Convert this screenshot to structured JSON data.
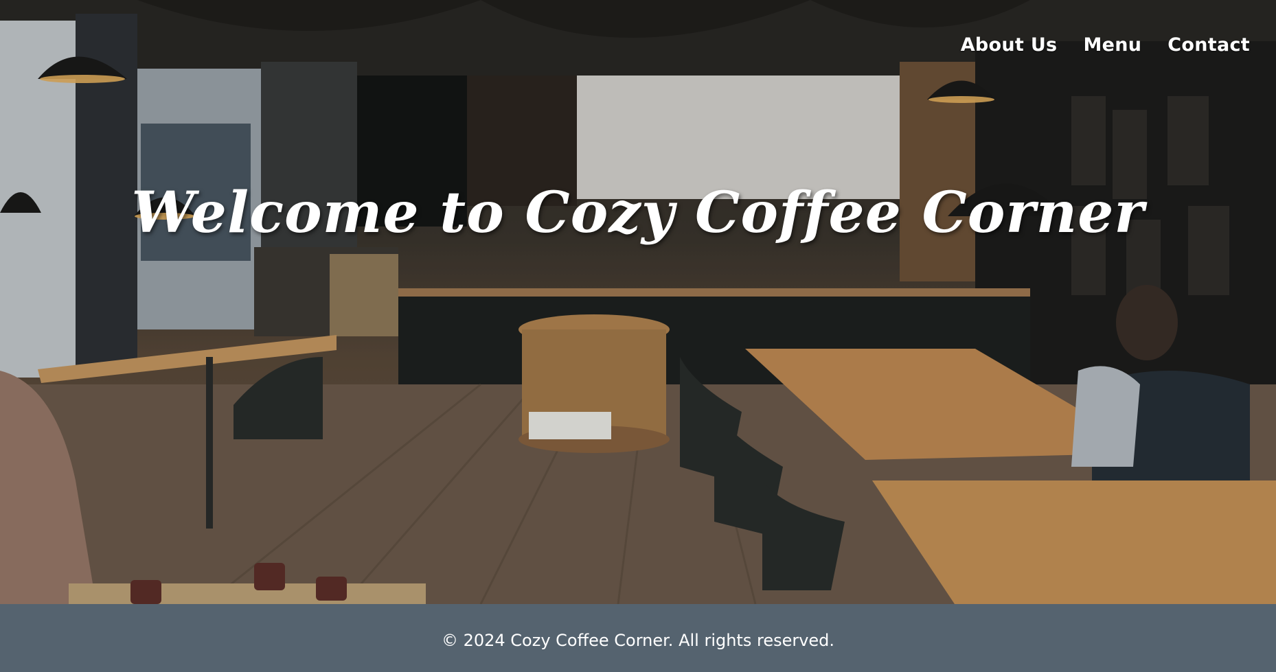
{
  "nav": {
    "items": [
      {
        "label": "About Us"
      },
      {
        "label": "Menu"
      },
      {
        "label": "Contact"
      }
    ]
  },
  "hero": {
    "title": "Welcome to Cozy Coffee Corner",
    "background_image": "cafe-interior-photo"
  },
  "footer": {
    "text": "© 2024 Cozy Coffee Corner. All rights reserved."
  },
  "colors": {
    "footer_bg": "#55636f",
    "text": "#ffffff"
  }
}
